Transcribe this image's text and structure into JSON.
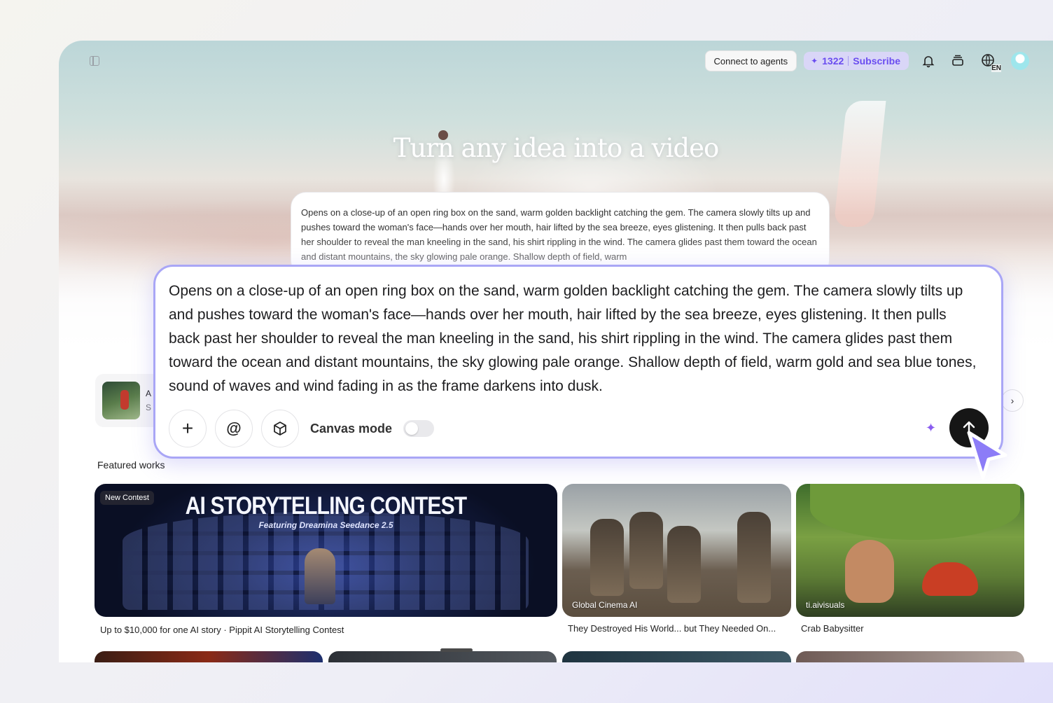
{
  "topbar": {
    "connect_label": "Connect to agents",
    "credits": "1322",
    "subscribe_label": "Subscribe",
    "language": "EN"
  },
  "hero": {
    "title": "Turn any idea into a video",
    "prompt_preview": "Opens on a close-up of an open ring box on the sand, warm golden backlight catching the gem. The camera slowly tilts up and pushes toward the woman's face—hands over her mouth, hair lifted by the sea breeze, eyes glistening. It then pulls back past her shoulder to reveal the man kneeling in the sand, his shirt rippling in the wind. The camera glides past them toward the ocean and distant mountains, the sky glowing pale orange. Shallow depth of field, warm"
  },
  "composer": {
    "text": "Opens on a close-up of an open ring box on the sand, warm golden backlight catching the gem. The camera slowly tilts up and pushes toward the woman's face—hands over her mouth, hair lifted by the sea breeze, eyes glistening. It then pulls back past her shoulder to reveal the man kneeling in the sand, his shirt rippling in the wind. The camera glides past them toward the ocean and distant mountains, the sky glowing pale orange. Shallow depth of field, warm gold and sea blue tones, sound of waves and wind fading in as the frame darkens into dusk.",
    "add_icon": "+",
    "mention_icon": "@",
    "canvas_mode_label": "Canvas mode",
    "canvas_mode_on": false,
    "accent_color": "#a9a6f6"
  },
  "template_strip": {
    "item_title": "A",
    "item_sub": "S",
    "next_icon": "›"
  },
  "featured": {
    "section_title": "Featured works",
    "cards": [
      {
        "badge": "New Contest",
        "contest_title": "AI STORYTELLING CONTEST",
        "contest_subtitle": "Featuring Dreamina Seedance 2.5",
        "caption": "Up to $10,000 for one AI story · Pippit AI Storytelling Contest"
      },
      {
        "author": "Global Cinema AI",
        "caption": "They Destroyed His World... but They Needed On..."
      },
      {
        "author": "ti.aivisuals",
        "caption": "Crab Babysitter"
      }
    ]
  }
}
